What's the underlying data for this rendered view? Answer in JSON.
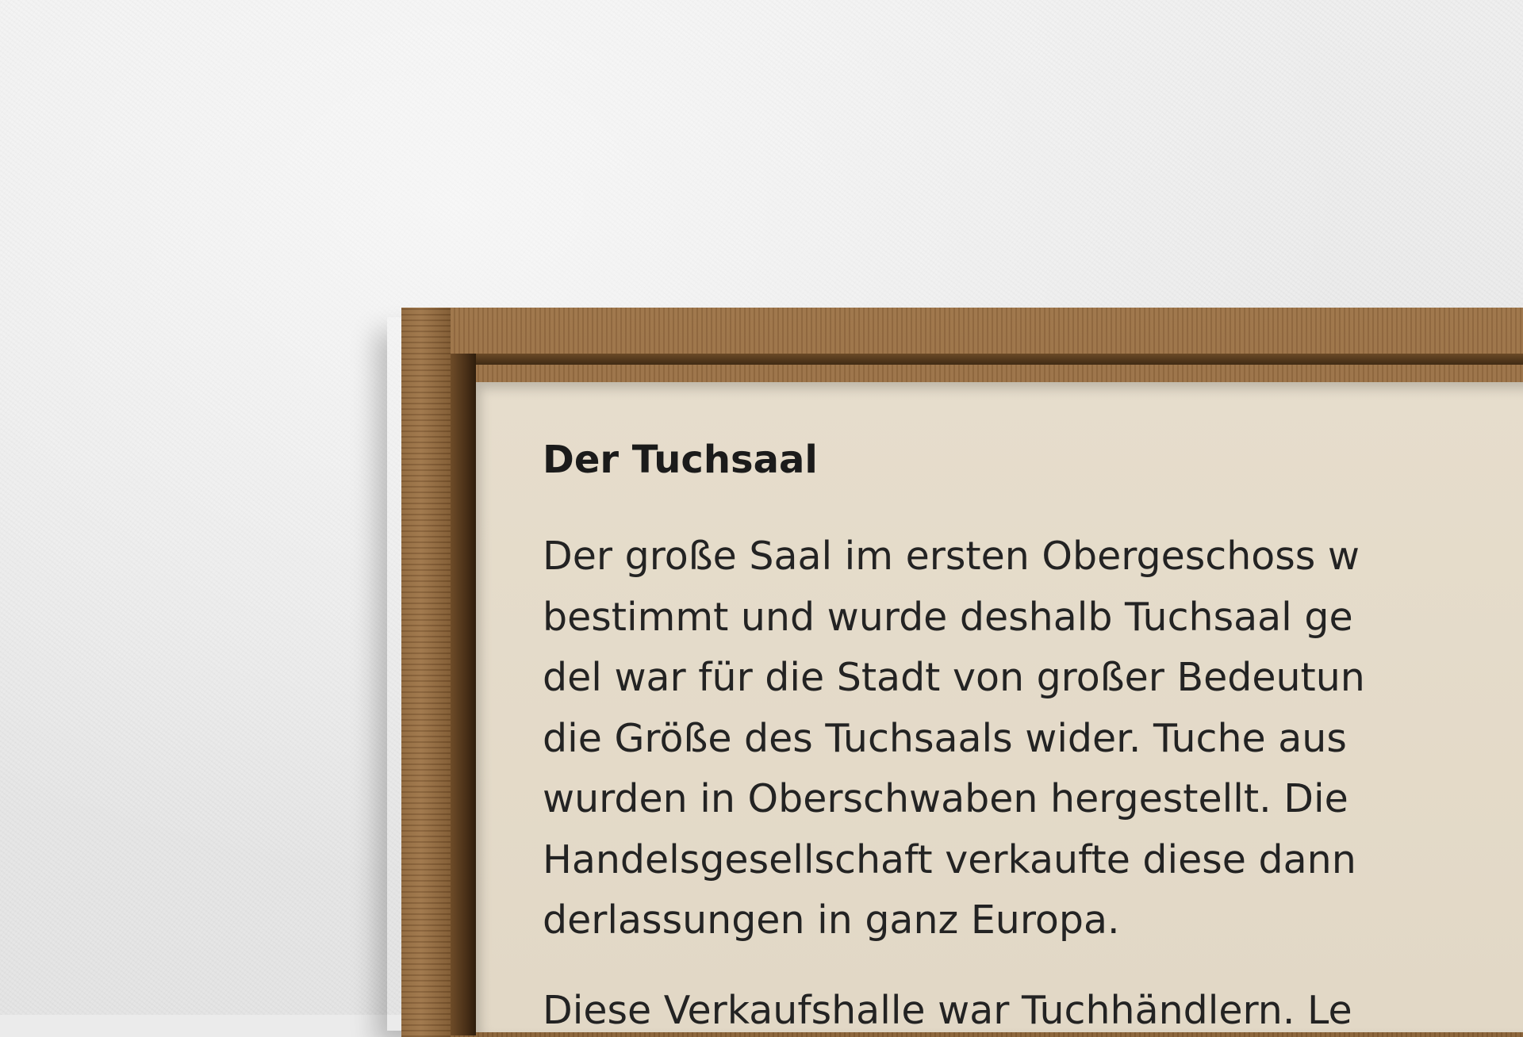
{
  "sign": {
    "title": "Der Tuchsaal",
    "paragraph_lines": [
      "Der große Saal im ersten Obergeschoss w",
      "bestimmt und wurde deshalb Tuchsaal ge",
      "del war für die Stadt von großer Bedeutun",
      "die Größe des Tuchsaals wider. Tuche aus",
      "wurden in Oberschwaben hergestellt. Die",
      "Handelsgesellschaft verkaufte diese dann",
      "derlassungen in ganz Europa."
    ],
    "next_paragraph_line": "Diese Verkaufshalle war Tuchhändlern. Le"
  },
  "colors": {
    "wall": "#ebebeb",
    "frame_wood": "#8f6840",
    "panel": "#e4dac8",
    "text": "#1b1b1b"
  }
}
